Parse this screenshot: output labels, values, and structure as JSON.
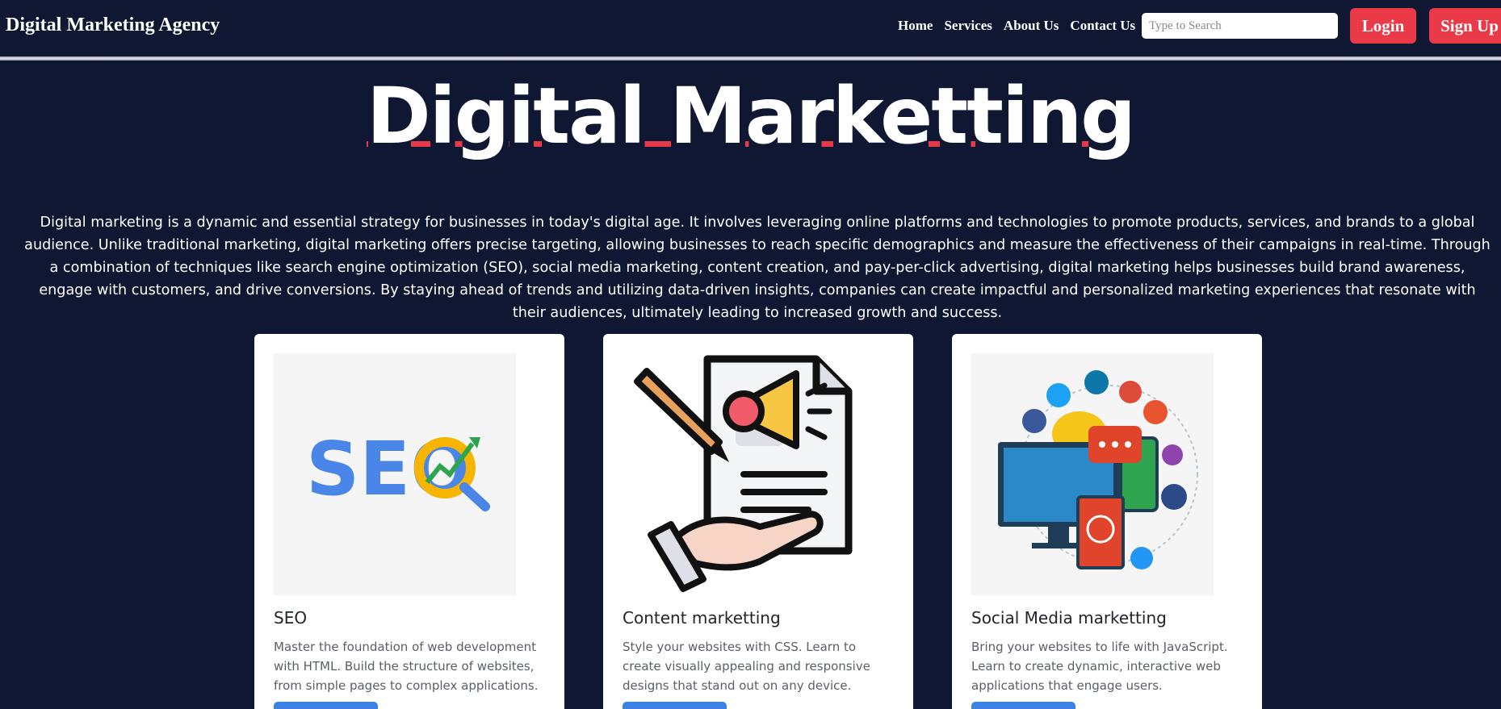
{
  "navbar": {
    "brand": "Digital Marketing Agency",
    "links": [
      "Home",
      "Services",
      "About Us",
      "Contact Us"
    ],
    "search_placeholder": "Type to Search",
    "login_label": "Login",
    "signup_label": "Sign Up"
  },
  "hero": {
    "title": "Digital Marketting",
    "intro": "Digital marketing is a dynamic and essential strategy for businesses in today's digital age. It involves leveraging online platforms and technologies to promote products, services, and brands to a global audience. Unlike traditional marketing, digital marketing offers precise targeting, allowing businesses to reach specific demographics and measure the effectiveness of their campaigns in real-time. Through a combination of techniques like search engine optimization (SEO), social media marketing, content creation, and pay-per-click advertising, digital marketing helps businesses build brand awareness, engage with customers, and drive conversions. By staying ahead of trends and utilizing data-driven insights, companies can create impactful and personalized marketing experiences that resonate with their audiences, ultimately leading to increased growth and success."
  },
  "cards": [
    {
      "title": "SEO",
      "text": "Master the foundation of web development with HTML. Build the structure of websites, from simple pages to complex applications.",
      "image_icon": "seo-magnifier-chart-icon",
      "image_text": "SEO"
    },
    {
      "title": "Content marketting",
      "text": "Style your websites with CSS. Learn to create visually appealing and responsive designs that stand out on any device.",
      "image_icon": "content-marketing-megaphone-document-icon"
    },
    {
      "title": "Social Media marketting",
      "text": "Bring your websites to life with JavaScript. Learn to create dynamic, interactive web applications that engage users.",
      "image_icon": "social-media-devices-network-icon"
    }
  ],
  "colors": {
    "background": "#0f1733",
    "accent_red": "#ea3a48",
    "accent_blue": "#3b82e6",
    "card_bg": "#ffffff"
  }
}
